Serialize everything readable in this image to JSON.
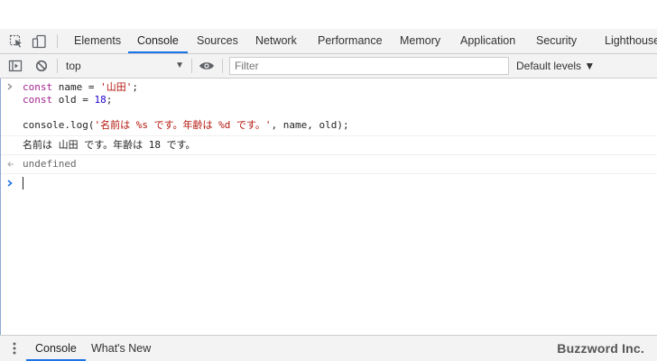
{
  "tabs": [
    {
      "label": "Elements",
      "active": false
    },
    {
      "label": "Console",
      "active": true
    },
    {
      "label": "Sources",
      "active": false
    },
    {
      "label": "Network",
      "active": false
    },
    {
      "label": "Performance",
      "active": false
    },
    {
      "label": "Memory",
      "active": false
    },
    {
      "label": "Application",
      "active": false
    },
    {
      "label": "Security",
      "active": false
    },
    {
      "label": "Lighthouse",
      "active": false
    }
  ],
  "toolbar": {
    "context": "top",
    "filter_placeholder": "Filter",
    "levels": "Default levels ▼"
  },
  "console": {
    "input_lines": [
      {
        "kw": "const",
        "rest": " name = ",
        "str": "'山田'",
        "tail": ";"
      },
      {
        "kw": "const",
        "rest": " old = ",
        "num": "18",
        "tail": ";"
      },
      {
        "text": ""
      },
      {
        "pre": "console.log(",
        "str": "'名前は %s です。年齢は %d です。'",
        "post": ", name, old);"
      }
    ],
    "log_output": "名前は 山田 です。年齢は 18 です。",
    "return_value": "undefined"
  },
  "drawer": {
    "tabs": [
      {
        "label": "Console",
        "active": true
      },
      {
        "label": "What's New",
        "active": false
      }
    ],
    "watermark": "Buzzword Inc."
  },
  "colors": {
    "accent": "#1a73e8",
    "keyword": "#a1248f",
    "string": "#b4160d",
    "number": "#1c00cf"
  }
}
